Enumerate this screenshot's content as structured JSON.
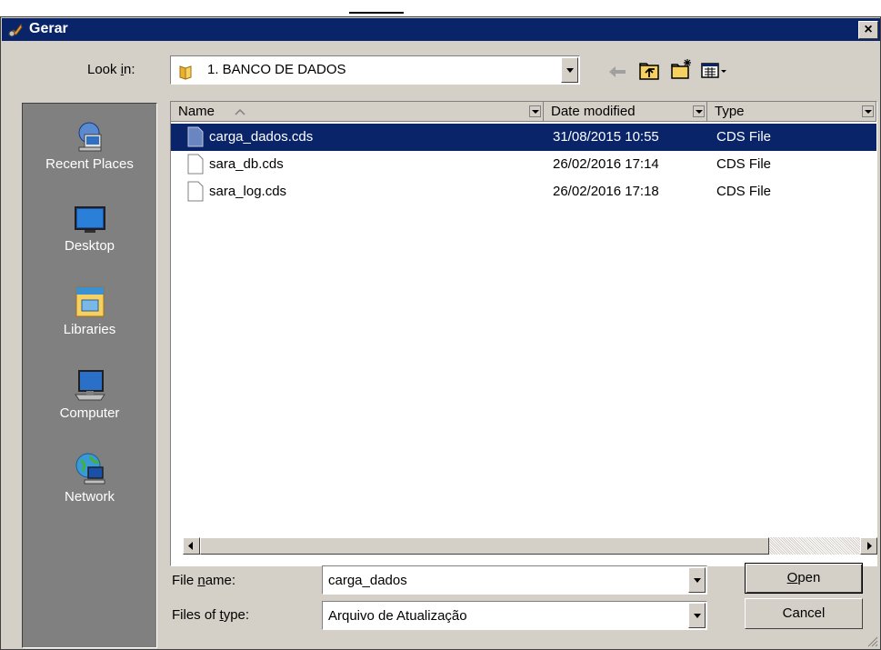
{
  "window": {
    "title": "Gerar",
    "close_glyph": "×"
  },
  "look_in": {
    "label_pre": "Look ",
    "label_key": "i",
    "label_post": "n:",
    "value": "1. BANCO DE DADOS"
  },
  "toolbar": {
    "back_icon": "back-arrow-icon",
    "up_icon": "up-folder-icon",
    "new_folder_icon": "new-folder-icon",
    "views_icon": "views-menu-icon"
  },
  "places": [
    {
      "label": "Recent Places",
      "icon": "recent-places-icon"
    },
    {
      "label": "Desktop",
      "icon": "desktop-icon"
    },
    {
      "label": "Libraries",
      "icon": "libraries-icon"
    },
    {
      "label": "Computer",
      "icon": "computer-icon"
    },
    {
      "label": "Network",
      "icon": "network-icon"
    }
  ],
  "columns": {
    "name": "Name",
    "date": "Date modified",
    "type": "Type"
  },
  "files": [
    {
      "name": "carga_dados.cds",
      "date": "31/08/2015 10:55",
      "type": "CDS File",
      "selected": true
    },
    {
      "name": "sara_db.cds",
      "date": "26/02/2016 17:14",
      "type": "CDS File",
      "selected": false
    },
    {
      "name": "sara_log.cds",
      "date": "26/02/2016 17:18",
      "type": "CDS File",
      "selected": false
    }
  ],
  "file_name": {
    "label_pre": "File ",
    "label_key": "n",
    "label_post": "ame:",
    "value": "carga_dados"
  },
  "file_type": {
    "label_pre": "Files of ",
    "label_key": "t",
    "label_post": "ype:",
    "value": "Arquivo de Atualização"
  },
  "buttons": {
    "open_key": "O",
    "open_rest": "pen",
    "cancel": "Cancel"
  },
  "colors": {
    "selection": "#0a246a",
    "face": "#d4d0c8",
    "places_bg": "#808080"
  }
}
